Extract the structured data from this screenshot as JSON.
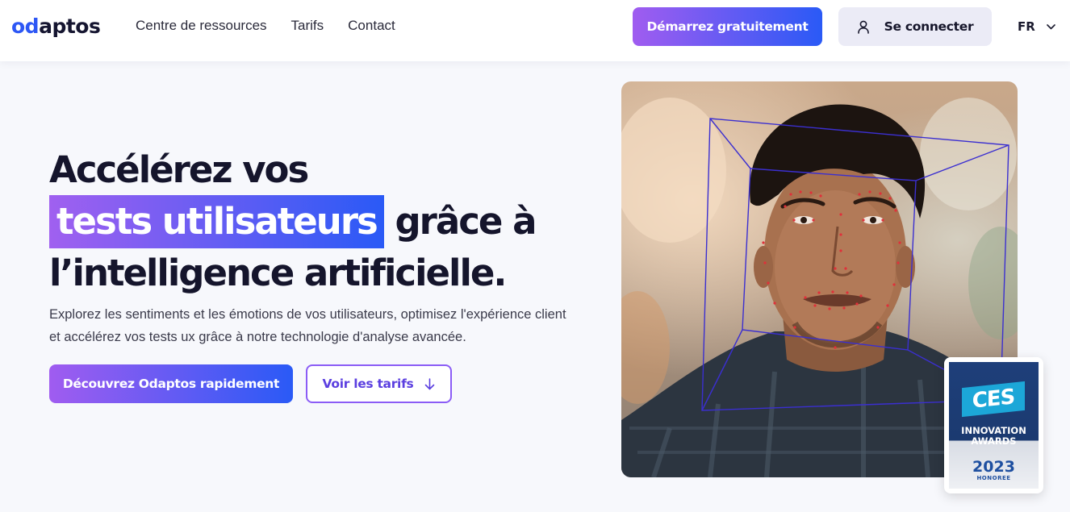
{
  "header": {
    "logo_prefix": "od",
    "logo_suffix": "aptos",
    "nav": [
      "Centre de ressources",
      "Tarifs",
      "Contact"
    ],
    "start_button": "Démarrez gratuitement",
    "login_button": "Se connecter",
    "language": "FR"
  },
  "hero": {
    "headline_line1": "Accélérez vos",
    "headline_highlight": "tests utilisateurs",
    "headline_line2_rest": "grâce à",
    "headline_line3": "l’intelligence artificielle.",
    "subtitle": "Explorez les sentiments et les émotions de vos utilisateurs, optimisez l'expérience client et accélérez vos tests ux grâce à notre technologie d'analyse avancée.",
    "primary_button": "Découvrez Odaptos rapidement",
    "secondary_button": "Voir les tarifs"
  },
  "badge": {
    "logo_text": "CES",
    "line1": "INNOVATION",
    "line2": "AWARDS",
    "year": "2023",
    "status": "HONOREE"
  },
  "colors": {
    "brand_blue": "#2a5af6",
    "brand_purple": "#a05cf0",
    "text_dark": "#15152c",
    "page_bg": "#f7f8fc"
  },
  "icons": {
    "login": "user-icon",
    "language": "chevron-down-icon",
    "pricing": "arrow-down-icon"
  }
}
